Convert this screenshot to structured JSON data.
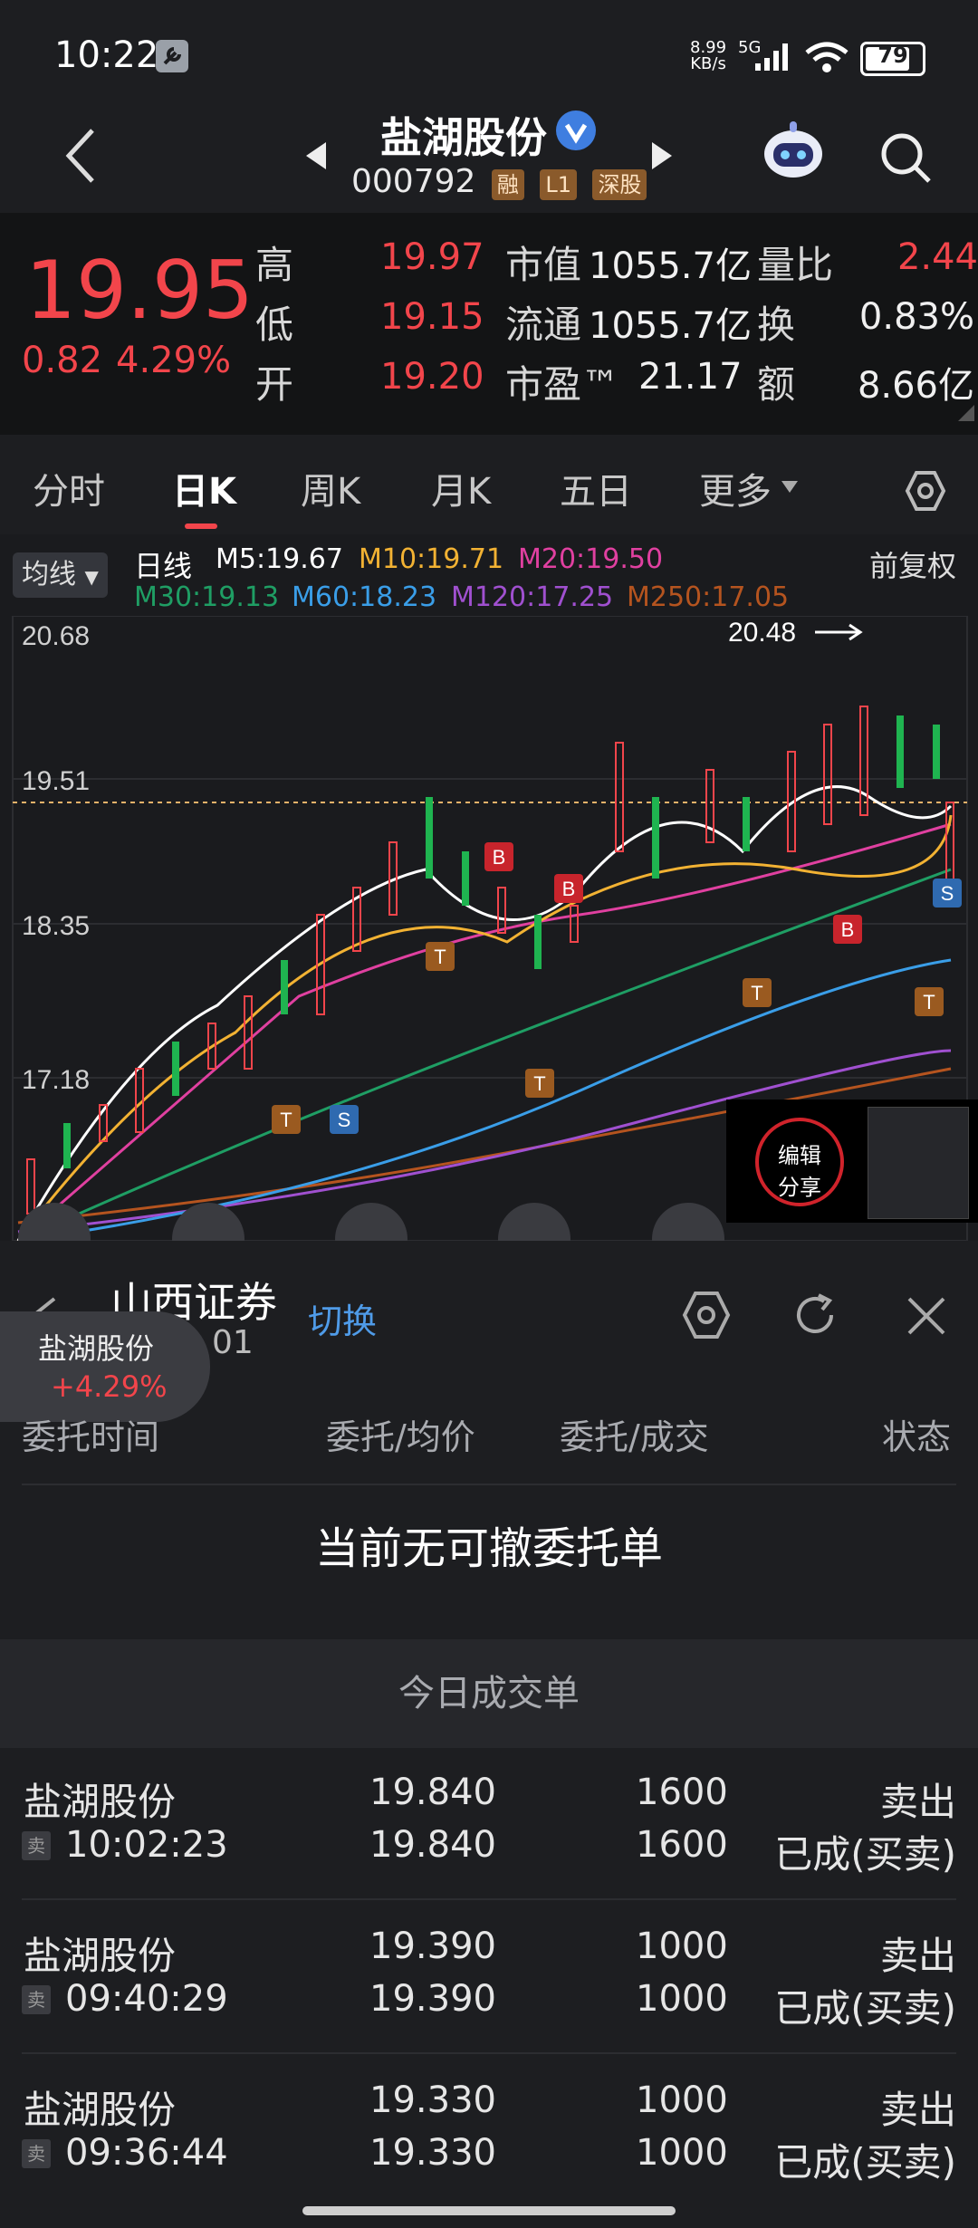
{
  "status_bar": {
    "time": "10:22",
    "net_speed": "8.99",
    "net_unit": "KB/s",
    "net_type": "5G",
    "battery": "79"
  },
  "header": {
    "stock_name": "盐湖股份",
    "stock_code": "000792",
    "badges": [
      "融",
      "L1",
      "深股"
    ]
  },
  "quote": {
    "price": "19.95",
    "change": "0.82",
    "change_pct": "4.29%",
    "high_label": "高",
    "high": "19.97",
    "low_label": "低",
    "low": "19.15",
    "open_label": "开",
    "open": "19.20",
    "mcap_label": "市值",
    "mcap": "1055.7亿",
    "float_label": "流通",
    "float": "1055.7亿",
    "pe_label": "市盈™",
    "pe": "21.17",
    "vol_ratio_label": "量比",
    "vol_ratio": "2.44",
    "turnover_label": "换",
    "turnover": "0.83%",
    "amount_label": "额",
    "amount": "8.66亿"
  },
  "tabs": {
    "items": [
      "分时",
      "日K",
      "周K",
      "月K",
      "五日",
      "更多"
    ],
    "active": "日K"
  },
  "chart": {
    "ma_selector": "均线",
    "period": "日线",
    "ma": [
      {
        "label": "M5:19.67",
        "color": "#ffffff"
      },
      {
        "label": "M10:19.71",
        "color": "#f2b233"
      },
      {
        "label": "M20:19.50",
        "color": "#e040a0"
      },
      {
        "label": "M30:19.13",
        "color": "#1f9e64"
      },
      {
        "label": "M60:18.23",
        "color": "#3a9ee8"
      },
      {
        "label": "M120:17.25",
        "color": "#a050d0"
      },
      {
        "label": "M250:17.05",
        "color": "#b5541f"
      }
    ],
    "adjust": "前复权",
    "y_labels": [
      "20.68",
      "19.51",
      "18.35",
      "17.18"
    ],
    "high_marker": "20.48",
    "float_menu": {
      "line1": "编辑",
      "line2": "分享"
    }
  },
  "float_card": {
    "name": "盐湖股份",
    "change": "+4.29%"
  },
  "panel": {
    "broker": "山西证券",
    "switch": "切换",
    "account_tail": "01",
    "columns": [
      "委托时间",
      "委托/均价",
      "委托/成交",
      "状态"
    ],
    "empty_text": "当前无可撤委托单",
    "section_title": "今日成交单",
    "trades": [
      {
        "name": "盐湖股份",
        "tag": "卖",
        "time": "10:02:23",
        "price1": "19.840",
        "price2": "19.840",
        "qty1": "1600",
        "qty2": "1600",
        "status1": "卖出",
        "status2": "已成(买卖)"
      },
      {
        "name": "盐湖股份",
        "tag": "卖",
        "time": "09:40:29",
        "price1": "19.390",
        "price2": "19.390",
        "qty1": "1000",
        "qty2": "1000",
        "status1": "卖出",
        "status2": "已成(买卖)"
      },
      {
        "name": "盐湖股份",
        "tag": "卖",
        "time": "09:36:44",
        "price1": "19.330",
        "price2": "19.330",
        "qty1": "1000",
        "qty2": "1000",
        "status1": "卖出",
        "status2": "已成(买卖)"
      }
    ]
  }
}
